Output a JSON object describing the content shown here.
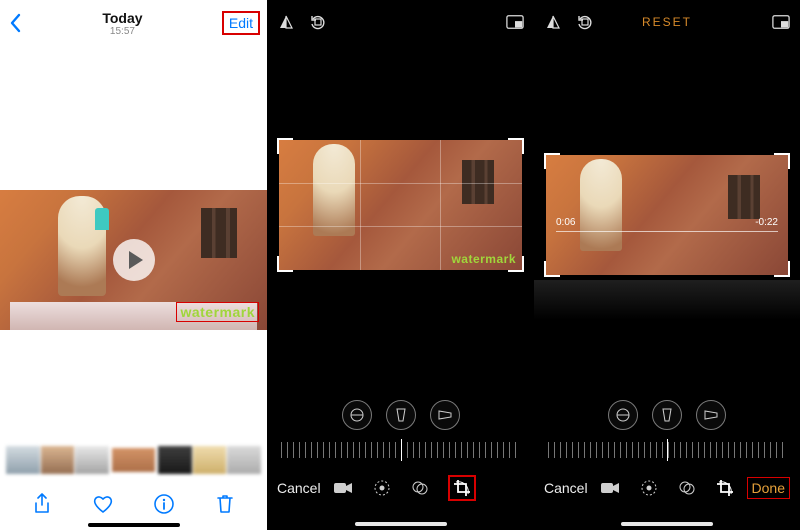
{
  "panel1": {
    "nav": {
      "title": "Today",
      "subtitle": "15:57",
      "edit": "Edit"
    },
    "watermark": "watermark",
    "icons": {
      "back": "chevron-left-icon",
      "share": "share-icon",
      "favorite": "heart-icon",
      "info": "info-icon",
      "trash": "trash-icon",
      "play": "play-icon"
    }
  },
  "panel2": {
    "watermark": "watermark",
    "cancel": "Cancel",
    "top_icons": {
      "flip_v": "flip-vertical-icon",
      "rotate": "rotate-icon",
      "aspect": "aspect-ratio-icon"
    },
    "adjust_icons": {
      "straighten": "straighten-icon",
      "vertical_perspective": "vertical-perspective-icon",
      "horizontal_perspective": "horizontal-perspective-icon"
    },
    "mode_icons": {
      "video": "video-icon",
      "adjust": "adjust-icon",
      "filters": "filters-icon",
      "crop": "crop-icon"
    }
  },
  "panel3": {
    "reset": "RESET",
    "cancel": "Cancel",
    "done": "Done",
    "time_elapsed": "0:06",
    "time_remaining": "-0:22",
    "top_icons": {
      "flip_v": "flip-vertical-icon",
      "rotate": "rotate-icon",
      "aspect": "aspect-ratio-icon"
    },
    "adjust_icons": {
      "straighten": "straighten-icon",
      "vertical_perspective": "vertical-perspective-icon",
      "horizontal_perspective": "horizontal-perspective-icon"
    },
    "mode_icons": {
      "video": "video-icon",
      "adjust": "adjust-icon",
      "filters": "filters-icon",
      "crop": "crop-icon"
    }
  },
  "highlights": {
    "edit": true,
    "watermark1": true,
    "crop_icon": true,
    "done": true
  }
}
